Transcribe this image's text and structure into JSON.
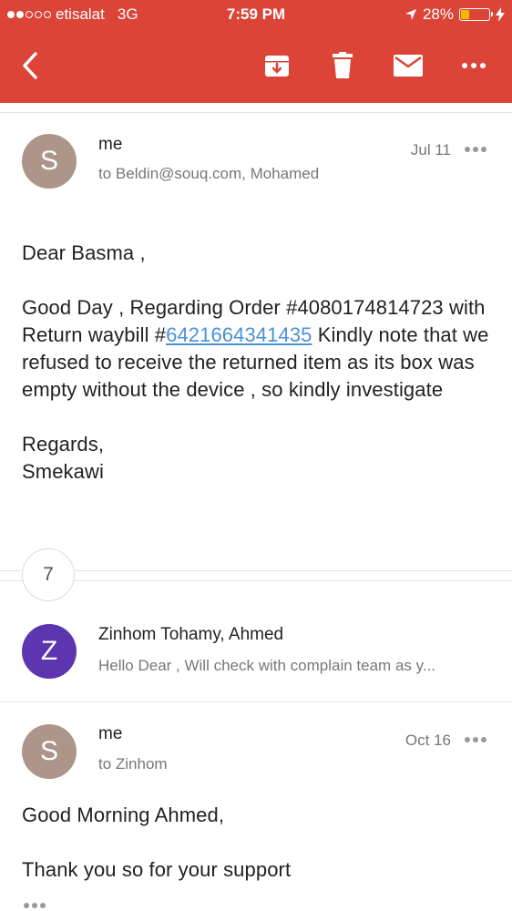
{
  "status_bar": {
    "carrier": "etisalat",
    "network": "3G",
    "time": "7:59 PM",
    "battery": "28%",
    "battery_level": 0.28
  },
  "toolbar": {
    "back_icon": "chevron-left-icon",
    "actions": [
      "archive-icon",
      "trash-icon",
      "mail-icon",
      "more-icon"
    ]
  },
  "messages": [
    {
      "avatar_letter": "S",
      "avatar_color": "#ad958a",
      "sender": "me",
      "recipients": "to Beldin@souq.com, Mohamed",
      "date": "Jul 11",
      "greeting": "Dear Basma ,",
      "body_before_link": "Good Day , Regarding Order #4080174814723 with Return waybill #",
      "link": "6421664341435",
      "body_after_link": " Kindly note that we refused to receive the returned item as its box was empty without the device , so kindly investigate",
      "signoff": "Regards,",
      "signature": "Smekawi"
    },
    {
      "avatar_letter": "Z",
      "avatar_color": "#5e35b1",
      "sender": "Zinhom Tohamy, Ahmed",
      "snippet": "Hello Dear , Will check with complain team as y..."
    },
    {
      "avatar_letter": "S",
      "avatar_color": "#ad958a",
      "sender": "me",
      "recipients": "to Zinhom",
      "date": "Oct 16",
      "greeting": "Good Morning Ahmed,",
      "body": "Thank you so for your support"
    }
  ],
  "collapsed_count": "7"
}
